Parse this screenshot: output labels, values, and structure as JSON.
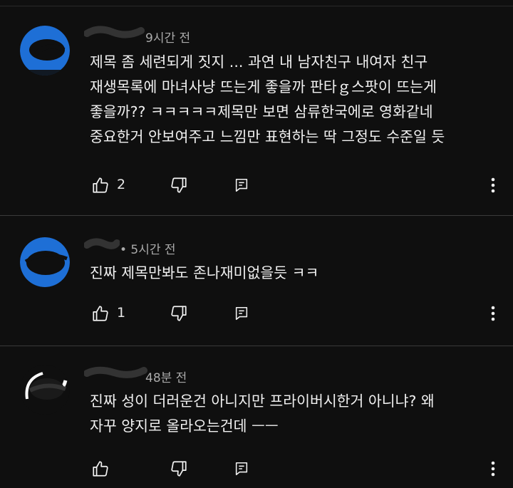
{
  "comments": [
    {
      "time": "9시간 전",
      "lines": [
        "제목 좀 세련되게 짓지 ... 과연 내 남자친구 내여자 친구",
        "재생목록에 마녀사냥 뜨는게 좋을까 판타ｇ스팟이 뜨는게",
        "좋을까?? ㅋㅋㅋㅋㅋ제목만 보면 삼류한국에로 영화같네",
        "중요한거 안보여주고 느낌만 표현하는 딱 그정도 수준일 듯"
      ],
      "likes": "2",
      "avatar_color": "#1e6fd6"
    },
    {
      "time": "• 5시간 전",
      "lines": [
        "진짜 제목만봐도 존나재미없을듯 ㅋㅋ"
      ],
      "likes": "1",
      "avatar_color": "#1e6fd6"
    },
    {
      "time": "48분 전",
      "lines": [
        "진짜 성이 더러운건 아니지만 프라이버시한거 아니냐? 왜",
        "자꾸 양지로 올라오는건데 ㅡㅡ"
      ],
      "likes": "",
      "avatar_color": "#ffffff"
    }
  ],
  "icons": {
    "like": "thumbs-up-icon",
    "dislike": "thumbs-down-icon",
    "reply": "reply-icon",
    "more": "more-vert-icon"
  },
  "colors": {
    "background": "#0f0f0f",
    "text": "#f1f1f1",
    "meta": "#aaaaaa",
    "divider": "#3a3a3a"
  }
}
